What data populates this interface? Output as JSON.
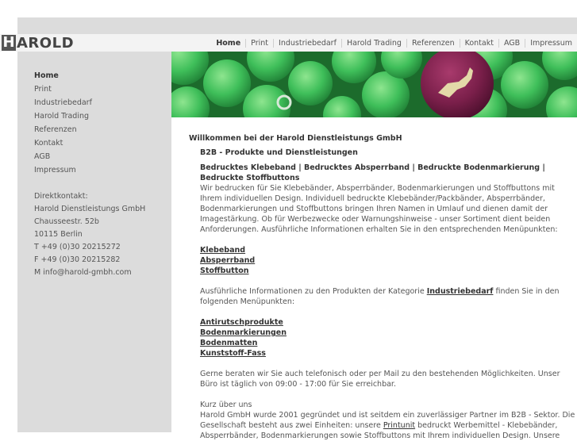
{
  "brand": {
    "logo_initial": "H",
    "logo_rest": "AROLD"
  },
  "topnav": [
    "Home",
    "Print",
    "Industriebedarf",
    "Harold Trading",
    "Referenzen",
    "Kontakt",
    "AGB",
    "Impressum"
  ],
  "sidenav": [
    "Home",
    "Print",
    "Industriebedarf",
    "Harold Trading",
    "Referenzen",
    "Kontakt",
    "AGB",
    "Impressum"
  ],
  "contact": {
    "label": "Direktkontakt:",
    "company": "Harold Dienstleistungs GmbH",
    "street": "Chausseestr. 52b",
    "city": "10115 Berlin",
    "phone": "T +49 (0)30 20215272",
    "fax": "F +49 (0)30 20215282",
    "mail": "M info@harold-gmbh.com"
  },
  "content": {
    "welcome": "Willkommen bei der Harold Dienstleistungs GmbH",
    "subtitle": "B2B - Produkte und Dienstleistungen",
    "products_heading": "Bedrucktes Klebeband | Bedrucktes Absperrband | Bedruckte Bodenmarkierung | Bedruckte Stoffbuttons",
    "intro": "Wir bedrucken für Sie Klebebänder, Absperrbänder, Bodenmarkierungen und Stoffbuttons mit Ihrem individuellen Design. Individuell bedruckte Klebebänder/Packbänder, Absperrbänder, Bodenmarkierungen und Stoffbuttons bringen Ihren Namen in Umlauf und dienen damit der Imagestärkung. Ob für Werbezwecke oder Warnungshinweise - unser Sortiment dient beiden Anforderungen. Ausführliche Informationen erhalten Sie in den entsprechenden Menüpunkten:",
    "links1": [
      "Klebeband",
      "Absperrband",
      "Stoffbutton"
    ],
    "industrie_pre": "Ausführliche Informationen zu den Produkten der Kategorie ",
    "industrie_link": "Industriebedarf",
    "industrie_post": " finden Sie in den folgenden Menüpunkten:",
    "links2": [
      "Antirutschprodukte",
      "Bodenmarkierungen",
      "Bodenmatten",
      "Kunststoff-Fass"
    ],
    "contact_text": "Gerne beraten wir Sie auch telefonisch oder per Mail zu den bestehenden Möglichkeiten. Unser Büro ist täglich von 09:00 - 17:00 für Sie erreichbar.",
    "about_title": "Kurz über uns",
    "about_pre": "Harold GmbH wurde 2001 gegründet und ist seitdem ein zuverlässiger Partner im B2B - Sektor. Die Gesellschaft besteht aus zwei Einheiten: unsere ",
    "about_link": "Printunit",
    "about_post": " bedruckt Werbemittel - Klebebänder, Absperrbänder, Bodenmarkierungen sowie Stoffbuttons mit Ihrem individuellen Design. Unsere"
  },
  "colors": {
    "sidebar": "#dcdcdc",
    "header": "#f3f3f3",
    "button_green": "#3fbf5a",
    "button_purple": "#7a1f4a"
  }
}
